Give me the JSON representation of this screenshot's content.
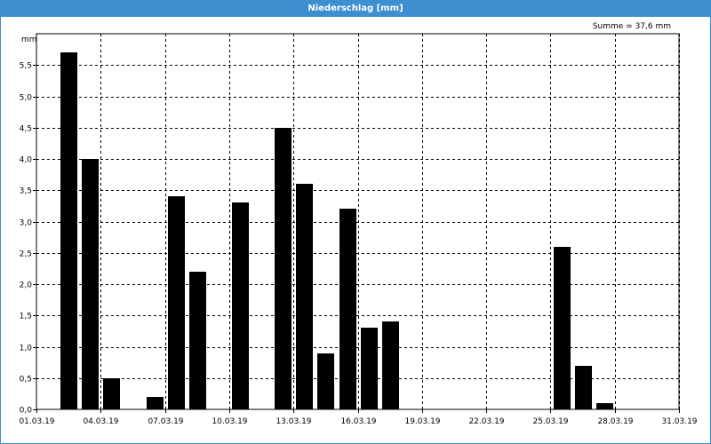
{
  "window": {
    "title": "Niederschlag [mm]"
  },
  "chart_data": {
    "type": "bar",
    "title": "Niederschlag [mm]",
    "annotation": "Summe = 37,6 mm",
    "ylabel": "mm",
    "xlabel": "",
    "ylim": [
      0,
      6.0
    ],
    "y_ticks": [
      "0,0",
      "0,5",
      "1,0",
      "1,5",
      "2,0",
      "2,5",
      "3,0",
      "3,5",
      "4,0",
      "4,5",
      "5,0",
      "5,5"
    ],
    "x_ticks": [
      "01.03.19",
      "04.03.19",
      "07.03.19",
      "10.03.19",
      "13.03.19",
      "16.03.19",
      "19.03.19",
      "22.03.19",
      "25.03.19",
      "28.03.19",
      "31.03.19"
    ],
    "grid": true,
    "colors": {
      "bar": "#000000",
      "title_bar": "#3d8fd0"
    },
    "categories": [
      "01.03.19",
      "02.03.19",
      "03.03.19",
      "04.03.19",
      "05.03.19",
      "06.03.19",
      "07.03.19",
      "08.03.19",
      "09.03.19",
      "10.03.19",
      "11.03.19",
      "12.03.19",
      "13.03.19",
      "14.03.19",
      "15.03.19",
      "16.03.19",
      "17.03.19",
      "18.03.19",
      "19.03.19",
      "20.03.19",
      "21.03.19",
      "22.03.19",
      "23.03.19",
      "24.03.19",
      "25.03.19",
      "26.03.19",
      "27.03.19",
      "28.03.19",
      "29.03.19",
      "30.03.19",
      "31.03.19"
    ],
    "values": [
      0,
      0,
      5.7,
      4.0,
      0.5,
      0,
      0.2,
      3.4,
      2.2,
      0,
      3.3,
      0,
      4.5,
      3.6,
      0.9,
      3.2,
      1.3,
      1.4,
      0,
      0,
      0,
      0,
      0,
      0,
      0,
      2.6,
      0.7,
      0.1,
      0,
      0,
      0
    ]
  }
}
